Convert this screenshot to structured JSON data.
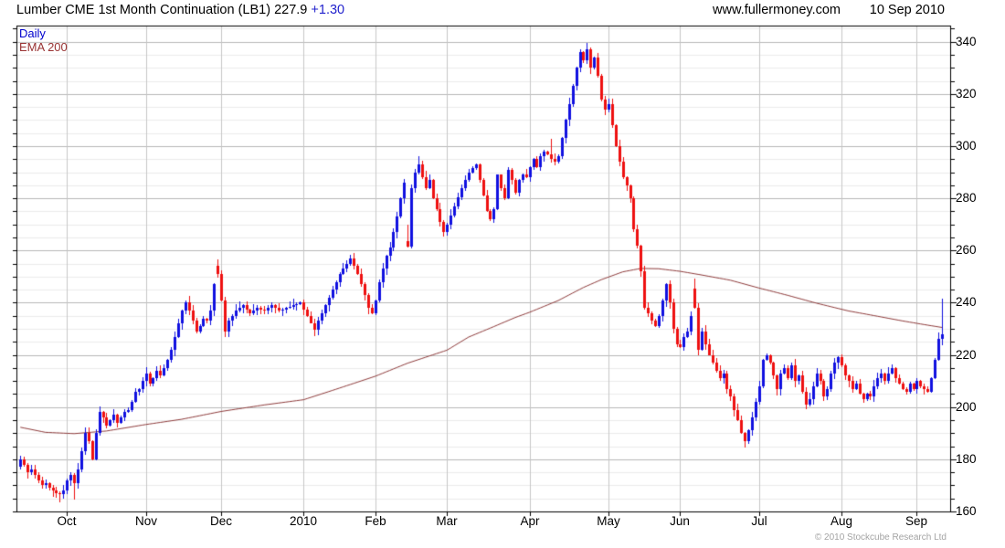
{
  "header": {
    "title_main": "Lumber CME 1st Month Continuation (LB1) 227.9",
    "title_change": "+1.30",
    "website": "www.fullermoney.com",
    "date": "10 Sep 2010"
  },
  "legend": {
    "daily_label": "Daily",
    "ema_label": "EMA 200"
  },
  "footer": {
    "copyright": "© 2010 Stockcube Research Ltd"
  },
  "colors": {
    "up_candle": "#1010e0",
    "down_candle": "#ee1010",
    "ema_line": "#8e3b3b",
    "legend_daily": "#0000cd",
    "legend_ema": "#993333",
    "grid_minor": "#ececec",
    "grid_major": "#b8b8b8",
    "grid_month": "#c6c6c6",
    "axis": "#000000"
  },
  "chart_data": {
    "type": "candlestick",
    "instrument": "Lumber CME 1st Month Continuation (LB1)",
    "last_price": 227.9,
    "change": 1.3,
    "as_of": "10 Sep 2010",
    "frequency": "Daily",
    "overlay": "EMA 200",
    "ylim": [
      160,
      346.2
    ],
    "y_major_ticks": [
      160,
      180,
      200,
      220,
      240,
      260,
      280,
      300,
      320,
      340
    ],
    "y_minor_step": 5,
    "grid": true,
    "legend_position": "top-left",
    "total_days": 260,
    "x_months": [
      {
        "label": "Oct",
        "day": 15
      },
      {
        "label": "Nov",
        "day": 37
      },
      {
        "label": "Dec",
        "day": 58
      },
      {
        "label": "2010",
        "day": 81
      },
      {
        "label": "Feb",
        "day": 101
      },
      {
        "label": "Mar",
        "day": 121
      },
      {
        "label": "Apr",
        "day": 144
      },
      {
        "label": "May",
        "day": 166
      },
      {
        "label": "Jun",
        "day": 186
      },
      {
        "label": "Jul",
        "day": 208
      },
      {
        "label": "Aug",
        "day": 231
      },
      {
        "label": "Sep",
        "day": 252
      }
    ],
    "series": [
      {
        "name": "Daily",
        "type": "ohlc_candles",
        "close_anchors": [
          [
            0,
            179
          ],
          [
            1,
            177
          ],
          [
            2,
            180
          ],
          [
            3,
            178
          ],
          [
            4,
            175
          ],
          [
            5,
            176
          ],
          [
            6,
            174
          ],
          [
            7,
            172
          ],
          [
            8,
            170
          ],
          [
            9,
            171
          ],
          [
            10,
            169
          ],
          [
            11,
            168
          ],
          [
            12,
            167
          ],
          [
            13,
            166.5
          ],
          [
            14,
            168
          ],
          [
            15,
            172
          ],
          [
            16,
            174
          ],
          [
            17,
            171
          ],
          [
            18,
            176
          ],
          [
            19,
            183
          ],
          [
            20,
            190
          ],
          [
            21,
            187
          ],
          [
            22,
            180
          ],
          [
            23,
            190
          ],
          [
            24,
            198
          ],
          [
            25,
            196
          ],
          [
            26,
            193
          ],
          [
            27,
            195
          ],
          [
            28,
            197
          ],
          [
            29,
            194
          ],
          [
            30,
            196
          ],
          [
            31,
            198
          ],
          [
            32,
            199
          ],
          [
            33,
            202
          ],
          [
            34,
            206
          ],
          [
            35,
            207
          ],
          [
            36,
            210
          ],
          [
            37,
            213
          ],
          [
            38,
            209
          ],
          [
            39,
            211
          ],
          [
            40,
            214
          ],
          [
            41,
            212
          ],
          [
            42,
            215
          ],
          [
            43,
            218
          ],
          [
            44,
            222
          ],
          [
            45,
            227
          ],
          [
            46,
            232
          ],
          [
            47,
            237
          ],
          [
            48,
            240
          ],
          [
            49,
            237
          ],
          [
            50,
            233
          ],
          [
            51,
            229
          ],
          [
            52,
            231
          ],
          [
            53,
            234
          ],
          [
            54,
            233
          ],
          [
            55,
            237
          ],
          [
            56,
            247
          ],
          [
            57,
            251
          ],
          [
            58,
            241
          ],
          [
            59,
            229
          ],
          [
            60,
            233
          ],
          [
            62,
            237
          ],
          [
            64,
            239
          ],
          [
            66,
            236
          ],
          [
            68,
            238
          ],
          [
            70,
            237
          ],
          [
            72,
            239
          ],
          [
            74,
            237
          ],
          [
            76,
            238
          ],
          [
            78,
            239
          ],
          [
            80,
            240
          ],
          [
            82,
            235
          ],
          [
            84,
            229.5
          ],
          [
            85,
            233
          ],
          [
            86,
            236
          ],
          [
            87,
            239
          ],
          [
            88,
            242
          ],
          [
            89,
            245
          ],
          [
            90,
            248
          ],
          [
            91,
            251
          ],
          [
            92,
            253
          ],
          [
            93,
            255
          ],
          [
            94,
            257
          ],
          [
            95,
            254
          ],
          [
            96,
            251
          ],
          [
            97,
            247
          ],
          [
            98,
            243
          ],
          [
            99,
            238
          ],
          [
            100,
            236
          ],
          [
            101,
            241
          ],
          [
            102,
            248
          ],
          [
            103,
            253
          ],
          [
            104,
            258
          ],
          [
            105,
            261
          ],
          [
            106,
            267
          ],
          [
            107,
            273
          ],
          [
            108,
            280
          ],
          [
            109,
            286
          ],
          [
            110,
            261.5
          ],
          [
            111,
            284
          ],
          [
            112,
            290
          ],
          [
            113,
            293
          ],
          [
            114,
            288
          ],
          [
            115,
            284
          ],
          [
            116,
            287
          ],
          [
            117,
            280
          ],
          [
            118,
            276
          ],
          [
            119,
            271
          ],
          [
            120,
            267
          ],
          [
            121,
            270
          ],
          [
            123,
            277
          ],
          [
            125,
            284
          ],
          [
            127,
            290
          ],
          [
            129,
            293
          ],
          [
            130,
            287
          ],
          [
            131,
            281
          ],
          [
            132,
            275
          ],
          [
            133,
            272
          ],
          [
            134,
            276
          ],
          [
            135,
            289
          ],
          [
            136,
            284
          ],
          [
            137,
            280
          ],
          [
            138,
            291
          ],
          [
            139,
            287
          ],
          [
            140,
            282
          ],
          [
            141,
            287
          ],
          [
            142,
            289
          ],
          [
            143,
            288
          ],
          [
            144,
            292
          ],
          [
            145,
            295
          ],
          [
            146,
            292
          ],
          [
            147,
            296
          ],
          [
            148,
            298
          ],
          [
            149,
            297
          ],
          [
            150,
            295
          ],
          [
            151,
            294
          ],
          [
            152,
            296
          ],
          [
            153,
            303
          ],
          [
            154,
            310
          ],
          [
            155,
            316
          ],
          [
            156,
            323
          ],
          [
            157,
            330
          ],
          [
            158,
            336
          ],
          [
            159,
            333
          ],
          [
            160,
            337
          ],
          [
            161,
            330
          ],
          [
            162,
            334
          ],
          [
            163,
            327
          ],
          [
            164,
            318
          ],
          [
            165,
            314
          ],
          [
            166,
            316
          ],
          [
            167,
            308
          ],
          [
            168,
            300
          ],
          [
            169,
            294
          ],
          [
            170,
            288
          ],
          [
            171,
            285
          ],
          [
            172,
            280
          ],
          [
            173,
            268
          ],
          [
            174,
            262
          ],
          [
            175,
            252
          ],
          [
            176,
            238
          ],
          [
            177,
            236
          ],
          [
            178,
            233
          ],
          [
            179,
            231
          ],
          [
            180,
            235
          ],
          [
            181,
            241
          ],
          [
            182,
            247
          ],
          [
            183,
            240
          ],
          [
            184,
            230
          ],
          [
            185,
            224
          ],
          [
            186,
            223
          ],
          [
            187,
            227
          ],
          [
            188,
            229
          ],
          [
            189,
            235
          ],
          [
            190,
            238
          ],
          [
            191,
            222
          ],
          [
            192,
            229
          ],
          [
            193,
            224
          ],
          [
            194,
            220
          ],
          [
            195,
            217
          ],
          [
            196,
            214
          ],
          [
            197,
            211
          ],
          [
            198,
            213
          ],
          [
            199,
            207
          ],
          [
            200,
            204
          ],
          [
            201,
            199
          ],
          [
            202,
            195
          ],
          [
            203,
            190
          ],
          [
            204,
            187
          ],
          [
            205,
            191
          ],
          [
            206,
            196
          ],
          [
            207,
            202
          ],
          [
            208,
            208
          ],
          [
            209,
            218
          ],
          [
            210,
            220
          ],
          [
            211,
            217
          ],
          [
            212,
            212
          ],
          [
            213,
            207
          ],
          [
            214,
            213
          ],
          [
            215,
            215
          ],
          [
            216,
            211
          ],
          [
            217,
            216
          ],
          [
            218,
            210
          ],
          [
            219,
            212
          ],
          [
            220,
            206
          ],
          [
            221,
            201
          ],
          [
            222,
            203
          ],
          [
            223,
            208
          ],
          [
            224,
            213
          ],
          [
            225,
            210
          ],
          [
            226,
            204
          ],
          [
            227,
            207
          ],
          [
            228,
            213
          ],
          [
            229,
            217
          ],
          [
            230,
            219
          ],
          [
            231,
            216
          ],
          [
            232,
            212
          ],
          [
            233,
            210
          ],
          [
            234,
            207
          ],
          [
            235,
            209
          ],
          [
            236,
            205
          ],
          [
            237,
            203
          ],
          [
            238,
            205
          ],
          [
            239,
            204
          ],
          [
            240,
            208
          ],
          [
            241,
            211
          ],
          [
            242,
            213
          ],
          [
            243,
            210
          ],
          [
            244,
            213
          ],
          [
            245,
            215
          ],
          [
            246,
            211
          ],
          [
            247,
            209
          ],
          [
            248,
            207
          ],
          [
            249,
            206
          ],
          [
            250,
            209
          ],
          [
            251,
            207
          ],
          [
            252,
            210
          ],
          [
            253,
            208
          ],
          [
            254,
            207
          ],
          [
            255,
            206
          ],
          [
            256,
            211
          ],
          [
            257,
            218
          ],
          [
            258,
            226
          ],
          [
            259,
            227.9
          ]
        ],
        "open_overrides": [
          [
            57,
            254
          ],
          [
            110,
            263.5
          ],
          [
            190,
            245.5
          ]
        ],
        "wick_overrides": [
          {
            "day": 13,
            "low": 163.5
          },
          {
            "day": 17,
            "low": 164.7
          },
          {
            "day": 57,
            "high": 256.5
          },
          {
            "day": 110,
            "high": 269.8
          },
          {
            "day": 113,
            "high": 296
          },
          {
            "day": 150,
            "high": 302.8
          },
          {
            "day": 160,
            "high": 339.5
          },
          {
            "day": 190,
            "high": 249.3
          },
          {
            "day": 204,
            "low": 184.5
          },
          {
            "day": 259,
            "high": 241.6
          }
        ]
      },
      {
        "name": "EMA 200",
        "type": "line",
        "anchors": [
          [
            0,
            193
          ],
          [
            9,
            190.5
          ],
          [
            17,
            190
          ],
          [
            26,
            191
          ],
          [
            37,
            193.5
          ],
          [
            47,
            195.5
          ],
          [
            58,
            198.5
          ],
          [
            70,
            201
          ],
          [
            81,
            203
          ],
          [
            90,
            207
          ],
          [
            101,
            212
          ],
          [
            110,
            217
          ],
          [
            121,
            222
          ],
          [
            127,
            227
          ],
          [
            134,
            231
          ],
          [
            140,
            234.5
          ],
          [
            144,
            236.5
          ],
          [
            152,
            241
          ],
          [
            159,
            246
          ],
          [
            164,
            249
          ],
          [
            170,
            252
          ],
          [
            175,
            253.3
          ],
          [
            180,
            253.2
          ],
          [
            186,
            252.2
          ],
          [
            192,
            250.8
          ],
          [
            200,
            248.8
          ],
          [
            208,
            245.8
          ],
          [
            216,
            243
          ],
          [
            224,
            240
          ],
          [
            233,
            237
          ],
          [
            241,
            235
          ],
          [
            248,
            233.2
          ],
          [
            254,
            231.8
          ],
          [
            259,
            230.7
          ]
        ]
      }
    ]
  }
}
